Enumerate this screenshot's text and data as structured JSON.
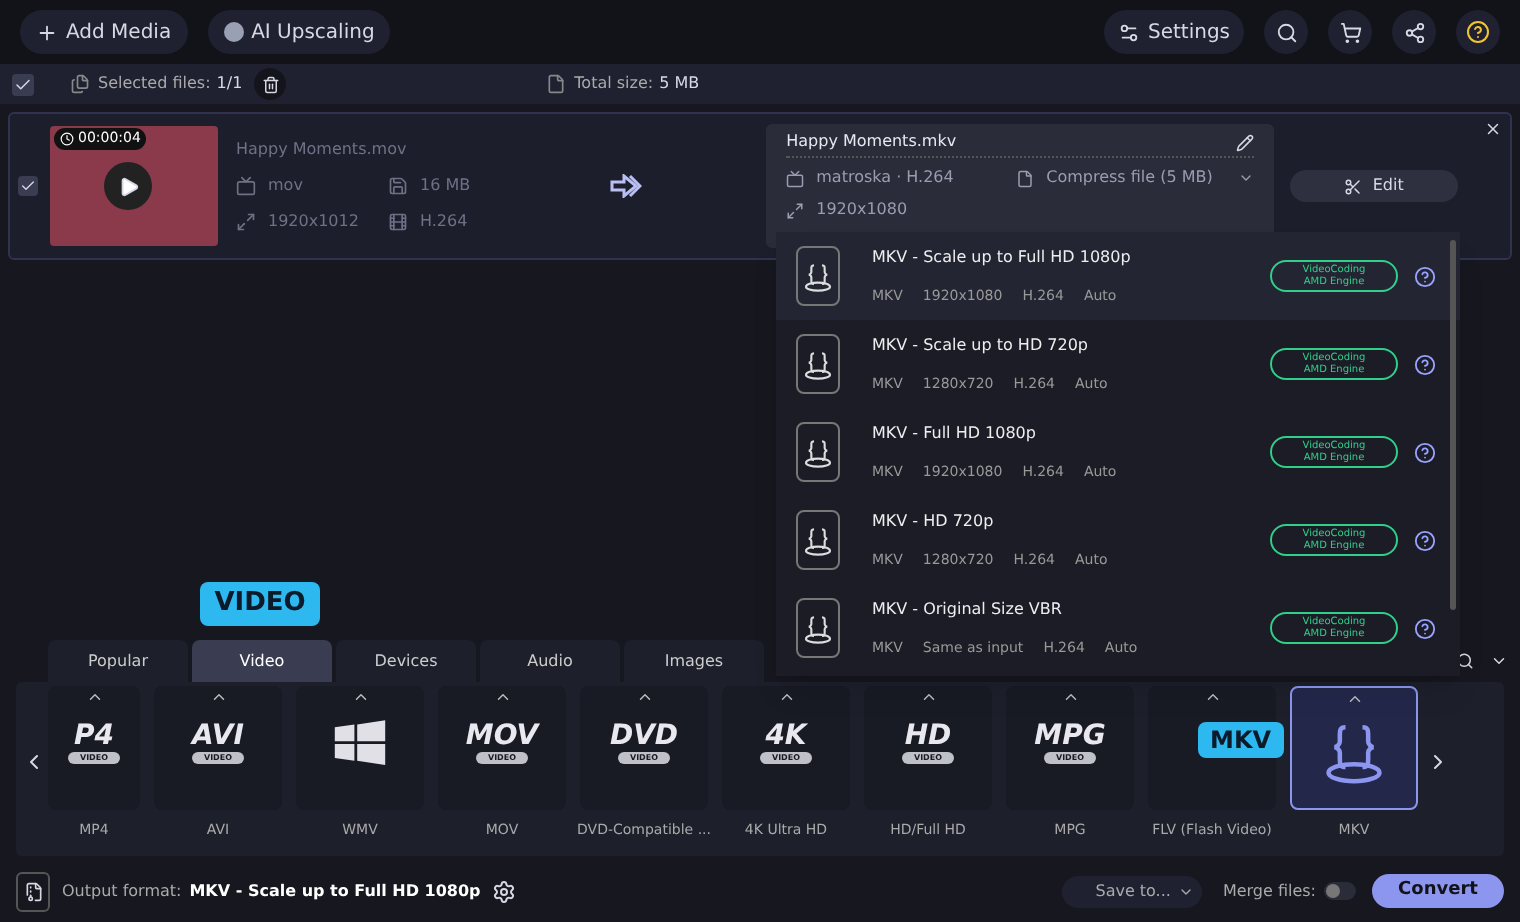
{
  "toolbar": {
    "add_media": "Add Media",
    "ai_upscaling": "AI Upscaling",
    "settings": "Settings"
  },
  "selection_bar": {
    "checked": true,
    "selected_label": "Selected files:",
    "selected_value": "1/1",
    "total_label": "Total size:",
    "total_value": "5 MB"
  },
  "file": {
    "checked": true,
    "timecode": "00:00:04",
    "name": "Happy Moments.mov",
    "container": "mov",
    "size": "16 MB",
    "resolution": "1920x1012",
    "codec": "H.264"
  },
  "output": {
    "name": "Happy Moments.mkv",
    "format": "matroska · H.264",
    "compress": "Compress file (5 MB)",
    "resolution": "1920x1080",
    "edit": "Edit"
  },
  "presets": [
    {
      "title": "MKV - Scale up to Full HD 1080p",
      "specs": [
        "MKV",
        "1920x1080",
        "H.264",
        "Auto"
      ],
      "badge_top": "VideoCoding",
      "badge_bottom": "AMD Engine",
      "selected": true
    },
    {
      "title": "MKV - Scale up to HD 720p",
      "specs": [
        "MKV",
        "1280x720",
        "H.264",
        "Auto"
      ],
      "badge_top": "VideoCoding",
      "badge_bottom": "AMD Engine",
      "selected": false
    },
    {
      "title": "MKV - Full HD 1080p",
      "specs": [
        "MKV",
        "1920x1080",
        "H.264",
        "Auto"
      ],
      "badge_top": "VideoCoding",
      "badge_bottom": "AMD Engine",
      "selected": false
    },
    {
      "title": "MKV - HD 720p",
      "specs": [
        "MKV",
        "1280x720",
        "H.264",
        "Auto"
      ],
      "badge_top": "VideoCoding",
      "badge_bottom": "AMD Engine",
      "selected": false
    },
    {
      "title": "MKV - Original Size VBR",
      "specs": [
        "MKV",
        "Same as input",
        "H.264",
        "Auto"
      ],
      "badge_top": "VideoCoding",
      "badge_bottom": "AMD Engine",
      "selected": false
    }
  ],
  "tabs": [
    {
      "label": "Popular",
      "selected": false
    },
    {
      "label": "Video",
      "selected": true
    },
    {
      "label": "Devices",
      "selected": false
    },
    {
      "label": "Audio",
      "selected": false
    },
    {
      "label": "Images",
      "selected": false
    }
  ],
  "tab_tooltip": "VIDEO",
  "formats": [
    {
      "kind": "logo",
      "logo": "P4",
      "sub": "VIDEO",
      "label": "MP4",
      "selected": false
    },
    {
      "kind": "logo",
      "logo": "AVI",
      "sub": "VIDEO",
      "label": "AVI",
      "selected": false
    },
    {
      "kind": "windows",
      "label": "WMV",
      "selected": false
    },
    {
      "kind": "logo",
      "logo": "MOV",
      "sub": "VIDEO",
      "label": "MOV",
      "selected": false
    },
    {
      "kind": "logo",
      "logo": "DVD",
      "sub": "VIDEO",
      "label": "DVD-Compatible ...",
      "selected": false
    },
    {
      "kind": "logo",
      "logo": "4K",
      "sub": "VIDEO",
      "label": "4K Ultra HD",
      "selected": false
    },
    {
      "kind": "logo",
      "logo": "HD",
      "sub": "VIDEO",
      "label": "HD/Full HD",
      "selected": false
    },
    {
      "kind": "logo",
      "logo": "MPG",
      "sub": "VIDEO",
      "label": "MPG",
      "selected": false
    },
    {
      "kind": "covered",
      "label": "FLV (Flash Video)",
      "selected": false
    },
    {
      "kind": "braces",
      "label": "MKV",
      "selected": true
    }
  ],
  "format_tooltip": "MKV",
  "bottom_bar": {
    "output_label": "Output format:",
    "output_value": "MKV - Scale up to Full HD 1080p",
    "save_to": "Save to...",
    "merge_label": "Merge files:",
    "merge_on": false,
    "convert": "Convert"
  }
}
